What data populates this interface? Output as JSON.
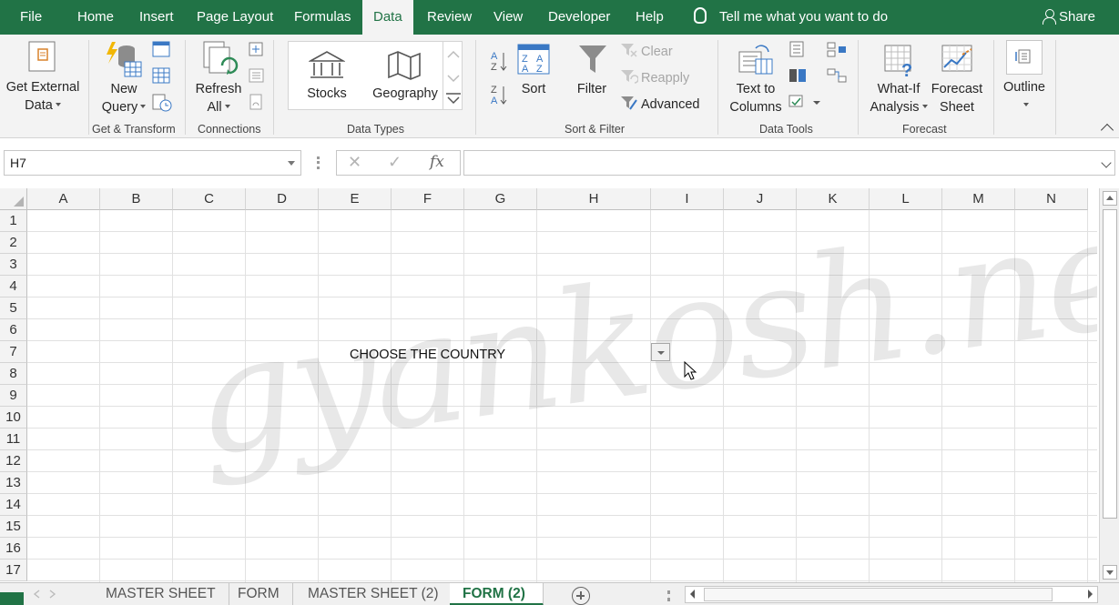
{
  "ribbon_tabs": [
    {
      "label": "File"
    },
    {
      "label": "Home"
    },
    {
      "label": "Insert"
    },
    {
      "label": "Page Layout"
    },
    {
      "label": "Formulas"
    },
    {
      "label": "Data"
    },
    {
      "label": "Review"
    },
    {
      "label": "View"
    },
    {
      "label": "Developer"
    },
    {
      "label": "Help"
    }
  ],
  "active_tab": "Data",
  "tell_me": "Tell me what you want to do",
  "share": "Share",
  "groups": {
    "get_transform": {
      "label": "Get & Transform",
      "get_external_1": "Get External",
      "get_external_2": "Data",
      "new_query_1": "New",
      "new_query_2": "Query"
    },
    "connections": {
      "label": "Connections",
      "refresh_1": "Refresh",
      "refresh_2": "All"
    },
    "data_types": {
      "label": "Data Types",
      "stocks": "Stocks",
      "geography": "Geography"
    },
    "sort_filter": {
      "label": "Sort & Filter",
      "sort": "Sort",
      "filter": "Filter",
      "clear": "Clear",
      "reapply": "Reapply",
      "advanced": "Advanced"
    },
    "data_tools": {
      "label": "Data Tools",
      "text_to_columns_1": "Text to",
      "text_to_columns_2": "Columns"
    },
    "forecast": {
      "label": "Forecast",
      "whatif_1": "What-If",
      "whatif_2": "Analysis",
      "forecast_1": "Forecast",
      "forecast_2": "Sheet"
    },
    "outline": {
      "label": "Outline"
    }
  },
  "formula_bar": {
    "name_box": "H7",
    "formula": ""
  },
  "columns": [
    "A",
    "B",
    "C",
    "D",
    "E",
    "F",
    "G",
    "H",
    "I",
    "J",
    "K",
    "L",
    "M",
    "N"
  ],
  "rows": [
    "1",
    "2",
    "3",
    "4",
    "5",
    "6",
    "7",
    "8",
    "9",
    "10",
    "11",
    "12",
    "13",
    "14",
    "15",
    "16",
    "17"
  ],
  "cell_e7": "CHOOSE THE COUNTRY",
  "watermark": "gyankosh.net",
  "sheet_tabs": [
    {
      "label": "MASTER SHEET"
    },
    {
      "label": "FORM"
    },
    {
      "label": "MASTER SHEET (2)"
    },
    {
      "label": "FORM (2)"
    }
  ],
  "active_sheet": "FORM (2)",
  "colors": {
    "excel_green": "#217346",
    "ribbon_bg": "#f3f3f3",
    "gridline": "#e1e1e1"
  }
}
